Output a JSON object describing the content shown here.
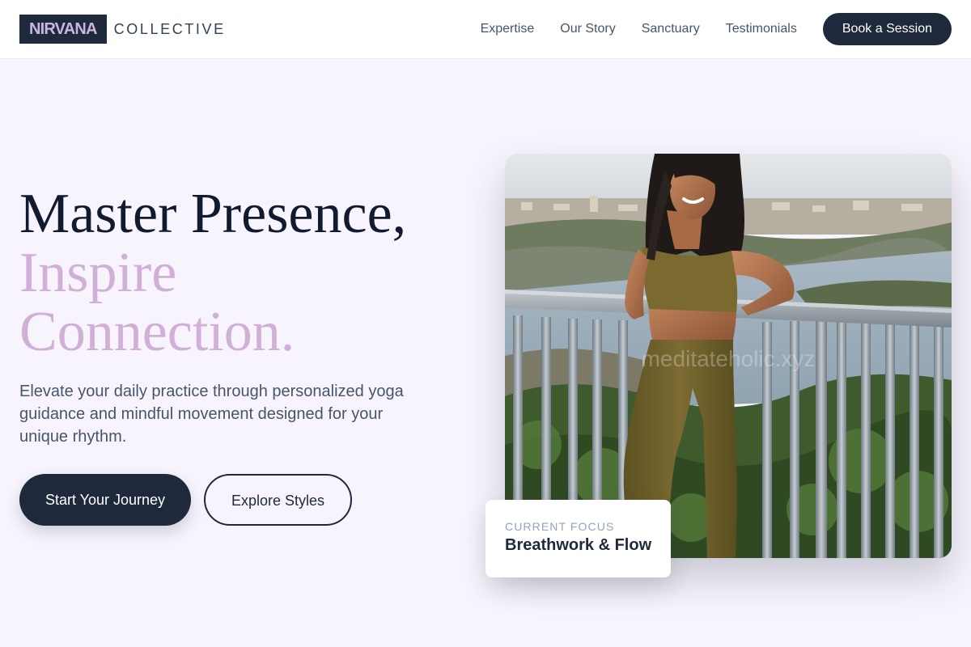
{
  "brand": {
    "mark": "NIRVANA",
    "name": "COLLECTIVE"
  },
  "nav": {
    "items": [
      {
        "label": "Expertise"
      },
      {
        "label": "Our Story"
      },
      {
        "label": "Sanctuary"
      },
      {
        "label": "Testimonials"
      }
    ],
    "cta_label": "Book a Session"
  },
  "hero": {
    "title_line1": "Master Presence,",
    "title_line2": "Inspire",
    "title_line3": "Connection.",
    "description": "Elevate your daily practice through personalized yoga guidance and mindful movement designed for your unique rhythm.",
    "primary_cta": "Start Your Journey",
    "secondary_cta": "Explore Styles"
  },
  "photo": {
    "watermark": "meditateholic.xyz"
  },
  "focus": {
    "label": "CURRENT FOCUS",
    "title": "Breathwork & Flow"
  },
  "colors": {
    "page_background": "#f7f4fd",
    "navy": "#1e293b",
    "lavender_accent": "#d1b0d8",
    "olive_outfit": "#76662e"
  }
}
